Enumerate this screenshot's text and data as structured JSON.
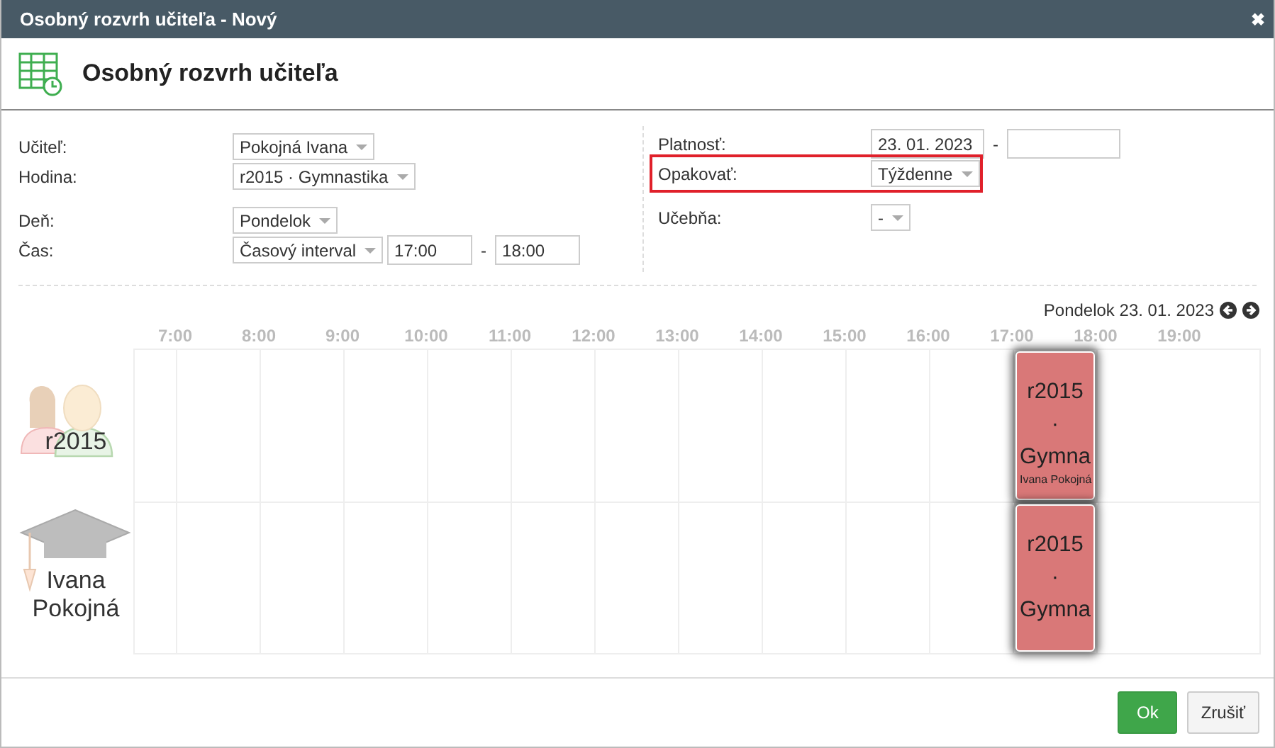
{
  "window": {
    "title": "Osobný rozvrh učiteľa - Nový",
    "close": "✖"
  },
  "header": {
    "title": "Osobný rozvrh učiteľa"
  },
  "form_left": [
    {
      "label": "Učiteľ:",
      "kind": "select",
      "value": "Pokojná Ivana"
    },
    {
      "label": "Hodina:",
      "kind": "select",
      "value": "r2015 · Gymnastika"
    },
    {
      "label": "Deň:",
      "kind": "select",
      "value": "Pondelok",
      "gap": true
    },
    {
      "label": "Čas:",
      "kind": "interval",
      "value": "Časový interval",
      "from": "17:00",
      "separator": "-",
      "to": "18:00"
    }
  ],
  "form_right": [
    {
      "label": "Platnosť:",
      "kind": "range",
      "from": "23. 01. 2023",
      "separator": "-",
      "highlighted": false
    },
    {
      "label": "Opakovať:",
      "kind": "select",
      "value": "Týždenne",
      "highlighted": true
    },
    {
      "label": "Učebňa:",
      "kind": "select",
      "value": "-",
      "highlighted": false,
      "gap": true
    }
  ],
  "calendar": {
    "date": "Pondelok 23. 01. 2023",
    "hours": [
      "7:00",
      "8:00",
      "9:00",
      "10:00",
      "11:00",
      "12:00",
      "13:00",
      "14:00",
      "15:00",
      "16:00",
      "17:00",
      "18:00",
      "19:00"
    ],
    "rows": [
      {
        "kind": "class",
        "label": "r2015",
        "event": {
          "title": "r2015 · Gymna",
          "subtitle": "Ivana Pokojná",
          "color": "#d97878"
        }
      },
      {
        "kind": "teacher",
        "label": "Ivana Pokojná",
        "event": {
          "title": "r2015 · Gymna",
          "color": "#d97878"
        }
      }
    ]
  },
  "buttons": [
    {
      "label": "Ok",
      "kind": "primary"
    },
    {
      "label": "Zrušiť",
      "kind": "default"
    }
  ]
}
